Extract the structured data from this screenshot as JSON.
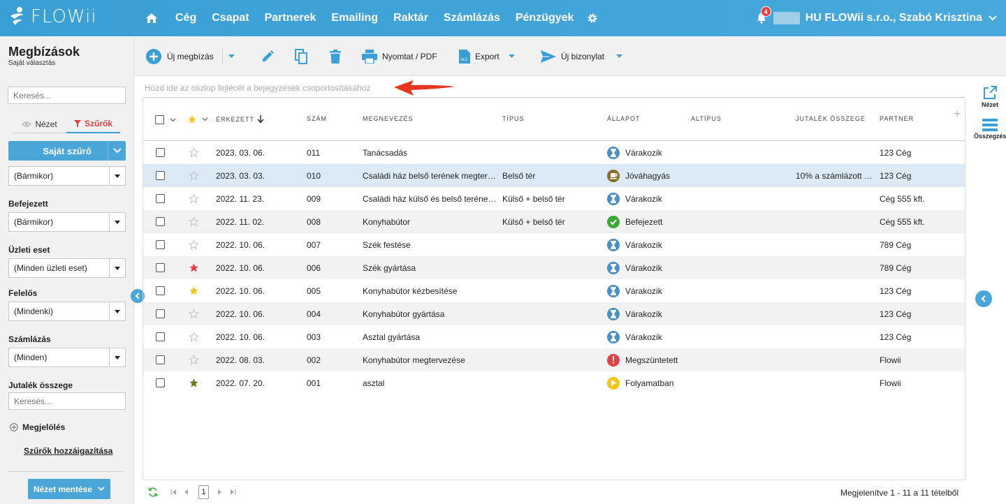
{
  "brand": {
    "name": "FLOWii"
  },
  "nav": {
    "items": [
      "Cég",
      "Csapat",
      "Partnerek",
      "Emailing",
      "Raktár",
      "Számlázás",
      "Pénzügyek"
    ]
  },
  "user": {
    "notification_count": "4",
    "company_user": "HU FLOWii s.r.o., Szabó Krisztina"
  },
  "page": {
    "title": "Megbízások",
    "subtitle": "Saját választás"
  },
  "sidebar": {
    "search_placeholder": "Keresés...",
    "tab_view": "Nézet",
    "tab_filters": "Szűrők",
    "own_filter": "Saját szűrő",
    "first_select_value": "(Bármikor)",
    "filters": [
      {
        "label": "Befejezett",
        "value": "(Bármikor)"
      },
      {
        "label": "Üzleti eset",
        "value": "(Minden üzleti eset)"
      },
      {
        "label": "Felelős",
        "value": "(Mindenki)"
      },
      {
        "label": "Számlázás",
        "value": "(Minden)"
      }
    ],
    "commission_label": "Jutalék összege",
    "commission_placeholder": "Keresés...",
    "marking": "Megjelölés",
    "assign_filters": "Szűrők hozzáigazítása",
    "save_view": "Nézet mentése"
  },
  "toolbar": {
    "new": "Új megbízás",
    "print": "Nyomtat / PDF",
    "export": "Export",
    "new_doc": "Új bizonylat"
  },
  "groupby": {
    "hint": "Húzd ide az oszlop fejlécét a bejegyzések csoportosításához"
  },
  "columns": {
    "received": "Érkezett",
    "number": "Szám",
    "name": "Megnevezés",
    "type": "Típus",
    "status": "Állapot",
    "subtype": "Altípus",
    "commission": "Jutalék összege",
    "partner": "Partner"
  },
  "rows": [
    {
      "star": "none",
      "date": "2023. 03. 06.",
      "num": "011",
      "name": "Tanácsadás",
      "type": "",
      "status": "Várakozik",
      "status_kind": "waiting",
      "commission": "",
      "partner": "123 Cég"
    },
    {
      "star": "none",
      "date": "2023. 03. 03.",
      "num": "010",
      "name": "Családi ház belső terének megter…",
      "type": "Belső tér",
      "status": "Jóváhagyás",
      "status_kind": "approval",
      "commission": "10% a számlázott …",
      "partner": "123 Cég"
    },
    {
      "star": "none",
      "date": "2022. 11. 23.",
      "num": "009",
      "name": "Családi ház külső és belső teréne…",
      "type": "Külső + belső tér",
      "status": "Várakozik",
      "status_kind": "waiting",
      "commission": "",
      "partner": "Cég 555 kft."
    },
    {
      "star": "none",
      "date": "2022. 11. 02.",
      "num": "008",
      "name": "Konyhabútor",
      "type": "Külső + belső tér",
      "status": "Befejezett",
      "status_kind": "done",
      "commission": "",
      "partner": "Cég 555 kft."
    },
    {
      "star": "none",
      "date": "2022. 10. 06.",
      "num": "007",
      "name": "Szék festése",
      "type": "",
      "status": "Várakozik",
      "status_kind": "waiting",
      "commission": "",
      "partner": "789 Cég"
    },
    {
      "star": "red",
      "date": "2022. 10. 06.",
      "num": "006",
      "name": "Szék gyártása",
      "type": "",
      "status": "Várakozik",
      "status_kind": "waiting",
      "commission": "",
      "partner": "789 Cég"
    },
    {
      "star": "yellow",
      "date": "2022. 10. 06.",
      "num": "005",
      "name": "Konyhabútor kézbesítése",
      "type": "",
      "status": "Várakozik",
      "status_kind": "waiting",
      "commission": "",
      "partner": "123 Cég"
    },
    {
      "star": "none",
      "date": "2022. 10. 06.",
      "num": "004",
      "name": "Konyhabútor gyártása",
      "type": "",
      "status": "Várakozik",
      "status_kind": "waiting",
      "commission": "",
      "partner": "123 Cég"
    },
    {
      "star": "none",
      "date": "2022. 10. 06.",
      "num": "003",
      "name": "Asztal gyártása",
      "type": "",
      "status": "Várakozik",
      "status_kind": "waiting",
      "commission": "",
      "partner": "123 Cég"
    },
    {
      "star": "none",
      "date": "2022. 08. 03.",
      "num": "002",
      "name": "Konyhabútor megtervezése",
      "type": "",
      "status": "Megszüntetett",
      "status_kind": "cancelled",
      "commission": "",
      "partner": "Flowii"
    },
    {
      "star": "olive",
      "date": "2022. 07. 20.",
      "num": "001",
      "name": "asztal",
      "type": "",
      "status": "Folyamatban",
      "status_kind": "progress",
      "commission": "",
      "partner": "Flowii"
    }
  ],
  "pager": {
    "current_page": "1",
    "info": "Megjelenítve 1 - 11 a 11 tételből"
  },
  "rail": {
    "view": "Nézet",
    "summary": "Összegzés"
  },
  "colors": {
    "brand": "#3a9fd4",
    "waiting": "#4a90c8",
    "approval": "#8a6d2b",
    "done": "#3aaa35",
    "cancelled": "#e34141",
    "progress": "#f5c518",
    "star_red": "#e34141",
    "star_yellow": "#f5c518",
    "star_olive": "#6b7a1f"
  }
}
